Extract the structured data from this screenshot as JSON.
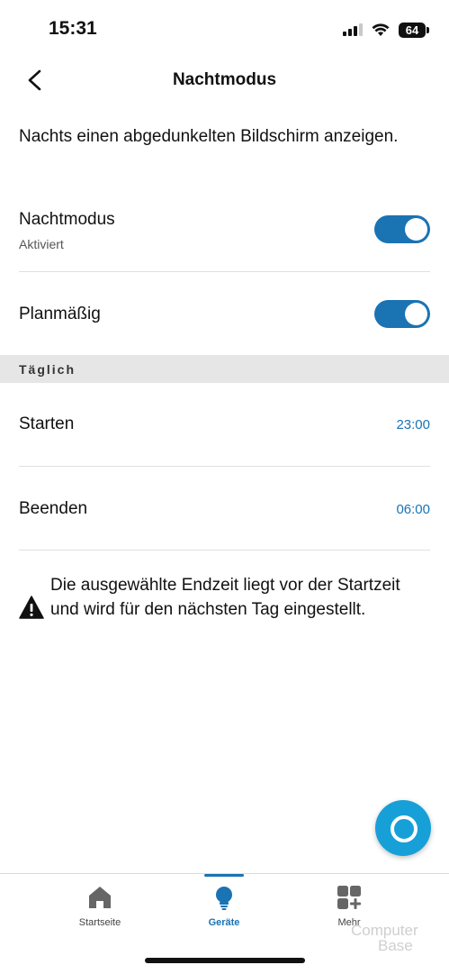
{
  "status_bar": {
    "time": "15:31",
    "battery": "64"
  },
  "header": {
    "title": "Nachtmodus",
    "back_icon": "chevron-left-icon"
  },
  "description": "Nachts einen abgedunkelten Bildschirm anzeigen.",
  "settings": {
    "night_mode": {
      "label": "Nachtmodus",
      "status": "Aktiviert",
      "enabled": true
    },
    "scheduled": {
      "label": "Planmäßig",
      "enabled": true
    }
  },
  "schedule": {
    "section_label": "Täglich",
    "start": {
      "label": "Starten",
      "time": "23:00"
    },
    "end": {
      "label": "Beenden",
      "time": "06:00"
    }
  },
  "warning": {
    "icon": "warning-icon",
    "text": "Die ausgewählte Endzeit liegt vor der Startzeit und wird für den nächsten Tag eingestellt."
  },
  "tabs": [
    {
      "label": "Startseite",
      "icon": "home-icon",
      "active": false
    },
    {
      "label": "Geräte",
      "icon": "lightbulb-icon",
      "active": true
    },
    {
      "label": "Mehr",
      "icon": "more-grid-icon",
      "active": false
    }
  ],
  "watermark": {
    "line1": "Computer",
    "line2": "Base"
  },
  "colors": {
    "accent": "#1a73b3",
    "alexa": "#17a0d8",
    "section_bg": "#e6e6e6"
  }
}
